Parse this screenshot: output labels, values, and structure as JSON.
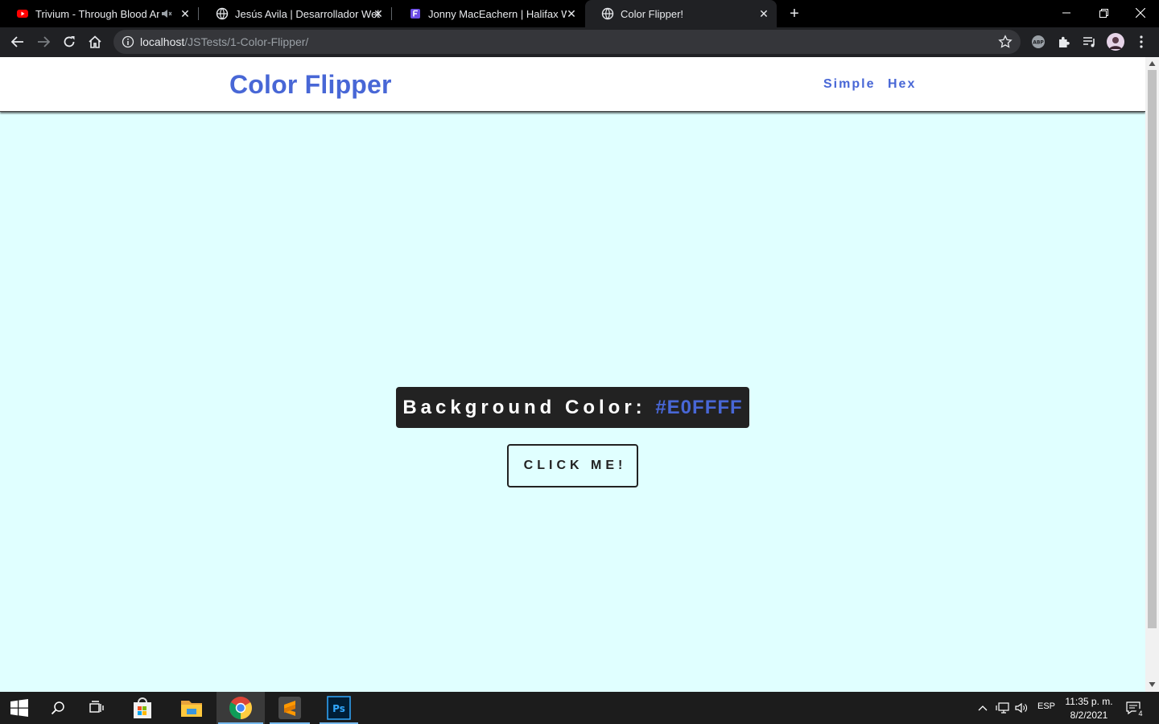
{
  "browser": {
    "tabs": [
      {
        "title": "Trivium - Through Blood And",
        "icon": "youtube-icon",
        "audio": true
      },
      {
        "title": "Jesús Avila | Desarrollador Web",
        "icon": "globe-icon"
      },
      {
        "title": "Jonny MacEachern | Halifax Word",
        "icon": "site-f-icon"
      },
      {
        "title": "Color Flipper!",
        "icon": "globe-icon",
        "active": true
      }
    ],
    "url_host": "localhost",
    "url_path": "/JSTests/1-Color-Flipper/"
  },
  "page": {
    "brand": "Color Flipper",
    "nav": [
      "Simple",
      "Hex"
    ],
    "bg_label": "Background Color:",
    "bg_value": "#E0FFFF",
    "button_label": "CLICK ME!",
    "colors": {
      "background": "#E0FFFF",
      "accent": "#4867D6",
      "dark": "#222222"
    }
  },
  "taskbar": {
    "apps": [
      "windows-start-icon",
      "search-icon",
      "task-view-icon",
      "store-icon",
      "file-explorer-icon",
      "chrome-icon",
      "sublime-text-icon",
      "photoshop-icon"
    ],
    "lang": "ESP",
    "time": "11:35 p. m.",
    "date": "8/2/2021",
    "notifications": "4"
  }
}
